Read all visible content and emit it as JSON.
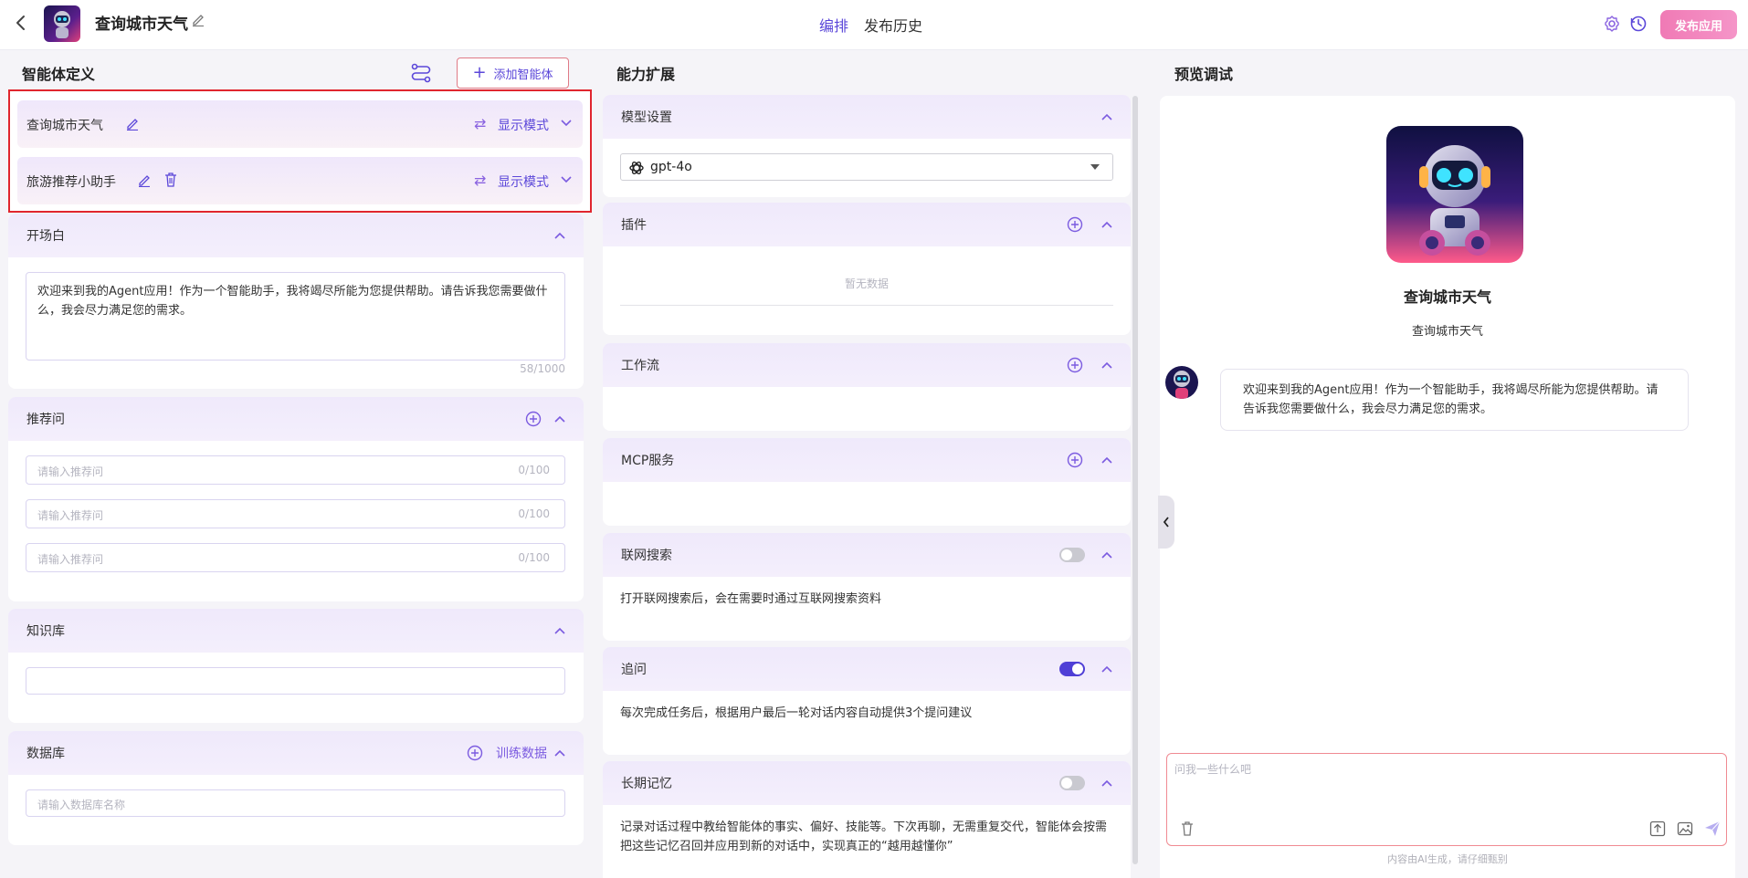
{
  "header": {
    "title": "查询城市天气",
    "tabs": [
      {
        "label": "编排",
        "active": true
      },
      {
        "label": "发布历史",
        "active": false
      }
    ],
    "publish_label": "发布应用"
  },
  "left": {
    "title": "智能体定义",
    "add_agent_label": "添加智能体",
    "agents": [
      {
        "name": "查询城市天气",
        "mode_label": "显示模式",
        "deletable": false
      },
      {
        "name": "旅游推荐小助手",
        "mode_label": "显示模式",
        "deletable": true
      }
    ],
    "opening": {
      "title": "开场白",
      "text": "欢迎来到我的Agent应用！作为一个智能助手，我将竭尽所能为您提供帮助。请告诉我您需要做什么，我会尽力满足您的需求。",
      "count": "58/1000"
    },
    "questions": {
      "title": "推荐问",
      "items": [
        {
          "placeholder": "请输入推荐问",
          "count": "0/100"
        },
        {
          "placeholder": "请输入推荐问",
          "count": "0/100"
        },
        {
          "placeholder": "请输入推荐问",
          "count": "0/100"
        }
      ]
    },
    "knowledge": {
      "title": "知识库"
    },
    "database": {
      "title": "数据库",
      "train_label": "训练数据",
      "placeholder": "请输入数据库名称"
    }
  },
  "middle": {
    "title": "能力扩展",
    "model": {
      "title": "模型设置",
      "value": "gpt-4o"
    },
    "plugins": {
      "title": "插件",
      "empty": "暂无数据"
    },
    "workflow": {
      "title": "工作流"
    },
    "mcp": {
      "title": "MCP服务"
    },
    "web_search": {
      "title": "联网搜索",
      "enabled": false,
      "desc": "打开联网搜索后，会在需要时通过互联网搜索资料"
    },
    "followup": {
      "title": "追问",
      "enabled": true,
      "desc": "每次完成任务后，根据用户最后一轮对话内容自动提供3个提问建议"
    },
    "memory": {
      "title": "长期记忆",
      "enabled": false,
      "desc": "记录对话过程中教给智能体的事实、偏好、技能等。下次再聊，无需重复交代，智能体会按需把这些记忆召回并应用到新的对话中，实现真正的“越用越懂你”"
    }
  },
  "preview": {
    "title": "预览调试",
    "app_name": "查询城市天气",
    "app_desc": "查询城市天气",
    "message": "欢迎来到我的Agent应用！作为一个智能助手，我将竭尽所能为您提供帮助。请告诉我您需要做什么，我会尽力满足您的需求。",
    "input_placeholder": "问我一些什么吧",
    "disclaimer": "内容由AI生成，请仔细甄别"
  },
  "colors": {
    "accent": "#5b47d9",
    "accent_light": "#7b5be0",
    "highlight_border": "#e0262e",
    "publish": "#f07ab5",
    "toggle_on": "#4f3fd6",
    "toggle_off": "#c9c9d0"
  }
}
